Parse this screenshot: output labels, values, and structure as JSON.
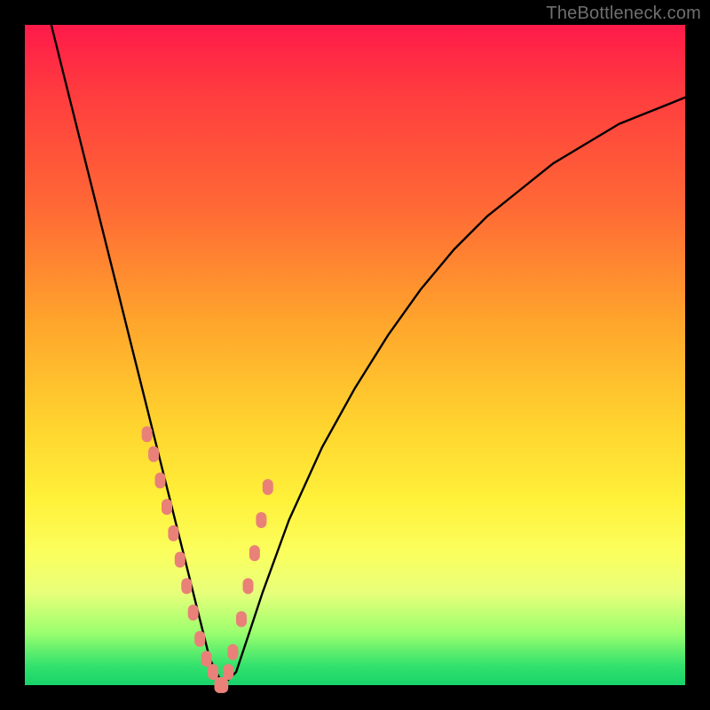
{
  "watermark": "TheBottleneck.com",
  "colors": {
    "background": "#000000",
    "curve": "#000000",
    "marker": "#e98178",
    "gradient": [
      "#ff1a4a",
      "#ff6a35",
      "#ffd22e",
      "#fbff5e",
      "#17d36a"
    ]
  },
  "chart_data": {
    "type": "line",
    "title": "",
    "xlabel": "",
    "ylabel": "",
    "xlim": [
      0,
      100
    ],
    "ylim": [
      0,
      100
    ],
    "grid": false,
    "series": [
      {
        "name": "bottleneck-curve",
        "x": [
          4,
          6,
          8,
          10,
          12,
          14,
          16,
          18,
          20,
          22,
          24,
          26,
          28,
          30,
          32,
          34,
          36,
          40,
          45,
          50,
          55,
          60,
          65,
          70,
          75,
          80,
          85,
          90,
          95,
          100
        ],
        "values": [
          100,
          92,
          84,
          76,
          68,
          60,
          52,
          44,
          36,
          28,
          20,
          12,
          4,
          0,
          2,
          8,
          14,
          25,
          36,
          45,
          53,
          60,
          66,
          71,
          75,
          79,
          82,
          85,
          87,
          89
        ]
      }
    ],
    "markers": {
      "name": "highlighted-points",
      "x": [
        18.5,
        19.5,
        20.5,
        21.5,
        22.5,
        23.5,
        24.5,
        25.5,
        26.5,
        27.5,
        28.5,
        29.5,
        30.0,
        30.8,
        31.5,
        32.8,
        33.8,
        34.8,
        35.8,
        36.8
      ],
      "values": [
        38,
        35,
        31,
        27,
        23,
        19,
        15,
        11,
        7,
        4,
        2,
        0,
        0,
        2,
        5,
        10,
        15,
        20,
        25,
        30
      ]
    },
    "optimum_x": 29.5
  }
}
